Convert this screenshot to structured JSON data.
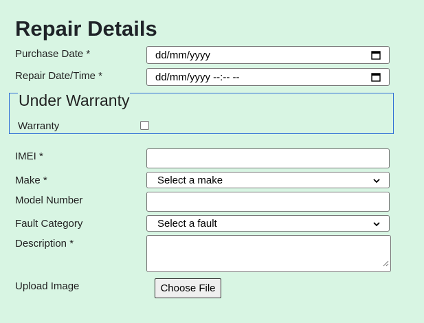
{
  "form": {
    "title": "Repair Details",
    "purchase_date": {
      "label": "Purchase Date *",
      "placeholder": "dd/mm/yyyy"
    },
    "repair_datetime": {
      "label": "Repair Date/Time *",
      "placeholder": "dd/mm/yyyy --:-- --"
    },
    "warranty_group": {
      "legend": "Under Warranty",
      "checkbox_label": "Warranty",
      "checked": false
    },
    "imei": {
      "label": "IMEI *",
      "value": ""
    },
    "make": {
      "label": "Make *",
      "selected": "Select a make"
    },
    "model_number": {
      "label": "Model Number",
      "value": ""
    },
    "fault_category": {
      "label": "Fault Category",
      "selected": "Select a fault"
    },
    "description": {
      "label": "Description *",
      "value": ""
    },
    "upload_image": {
      "label": "Upload Image",
      "button_label": "Choose File"
    }
  },
  "icons": {
    "date_picker": "calendar-icon",
    "dropdown": "chevron-down-icon",
    "resize": "resize-grip-icon"
  },
  "colors": {
    "background": "#d8f5e3",
    "fieldset_border": "#2f6fd6"
  }
}
